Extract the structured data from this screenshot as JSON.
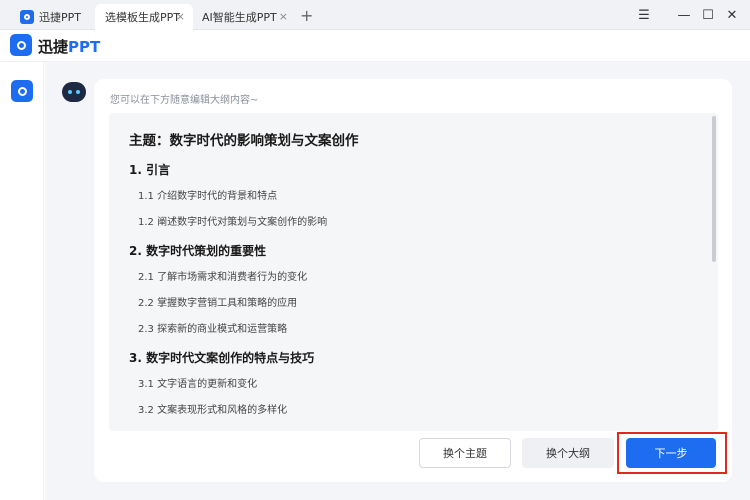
{
  "tabs": [
    {
      "label": "迅捷PPT"
    },
    {
      "label": "选模板生成PPT"
    },
    {
      "label": "AI智能生成PPT"
    }
  ],
  "icons": {
    "close": "×",
    "add": "+",
    "menu": "☰",
    "minimize": "—",
    "maximize": "☐",
    "window_close": "✕"
  },
  "app": {
    "name_prefix": "迅捷",
    "name_suffix": "PPT"
  },
  "hint": "您可以在下方随意编辑大纲内容~",
  "outline": {
    "topic": "主题：数字时代的影响策划与文案创作",
    "sections": [
      {
        "title": "1. 引言",
        "items": [
          "1.1 介绍数字时代的背景和特点",
          "1.2 阐述数字时代对策划与文案创作的影响"
        ]
      },
      {
        "title": "2. 数字时代策划的重要性",
        "items": [
          "2.1 了解市场需求和消费者行为的变化",
          "2.2 掌握数字营销工具和策略的应用",
          "2.3 探索新的商业模式和运营策略"
        ]
      },
      {
        "title": "3. 数字时代文案创作的特点与技巧",
        "items": [
          "3.1 文字语言的更新和变化",
          "3.2 文案表现形式和风格的多样化"
        ]
      }
    ]
  },
  "buttons": {
    "change_topic": "换个主题",
    "change_outline": "换个大纲",
    "next": "下一步"
  },
  "colors": {
    "accent": "#1e6cf0",
    "highlight": "#e0281e"
  }
}
